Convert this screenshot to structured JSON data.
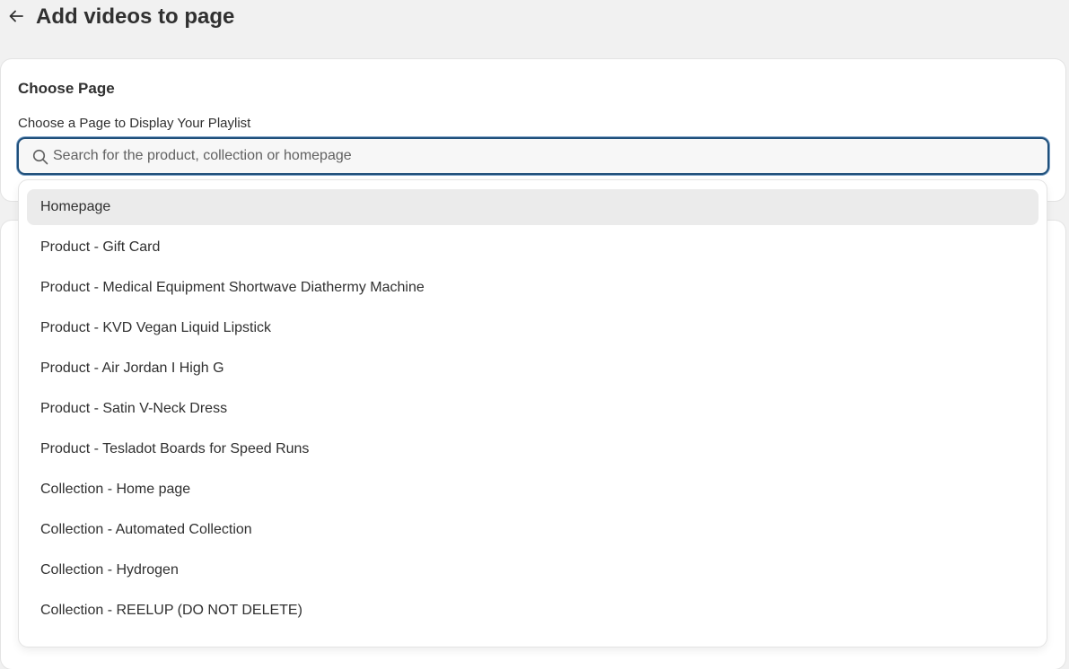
{
  "header": {
    "title": "Add videos to page",
    "back_icon": "arrow-left-icon"
  },
  "choose_page": {
    "title": "Choose Page",
    "label": "Choose a Page to Display Your Playlist",
    "search": {
      "placeholder": "Search for the product, collection or homepage",
      "value": "",
      "icon": "search-icon"
    }
  },
  "dropdown": {
    "options": [
      {
        "label": "Homepage",
        "highlighted": true
      },
      {
        "label": "Product - Gift Card",
        "highlighted": false
      },
      {
        "label": "Product - Medical Equipment Shortwave Diathermy Machine",
        "highlighted": false
      },
      {
        "label": "Product - KVD Vegan Liquid Lipstick",
        "highlighted": false
      },
      {
        "label": "Product - Air Jordan I High G",
        "highlighted": false
      },
      {
        "label": "Product - Satin V-Neck Dress",
        "highlighted": false
      },
      {
        "label": "Product - Tesladot Boards for Speed Runs",
        "highlighted": false
      },
      {
        "label": "Collection - Home page",
        "highlighted": false
      },
      {
        "label": "Collection - Automated Collection",
        "highlighted": false
      },
      {
        "label": "Collection - Hydrogen",
        "highlighted": false
      },
      {
        "label": "Collection - REELUP (DO NOT DELETE)",
        "highlighted": false
      }
    ]
  },
  "colors": {
    "background": "#f1f1f1",
    "card": "#ffffff",
    "focus_border": "#1f4f7a",
    "highlight": "#ebebeb",
    "text": "#303030"
  }
}
